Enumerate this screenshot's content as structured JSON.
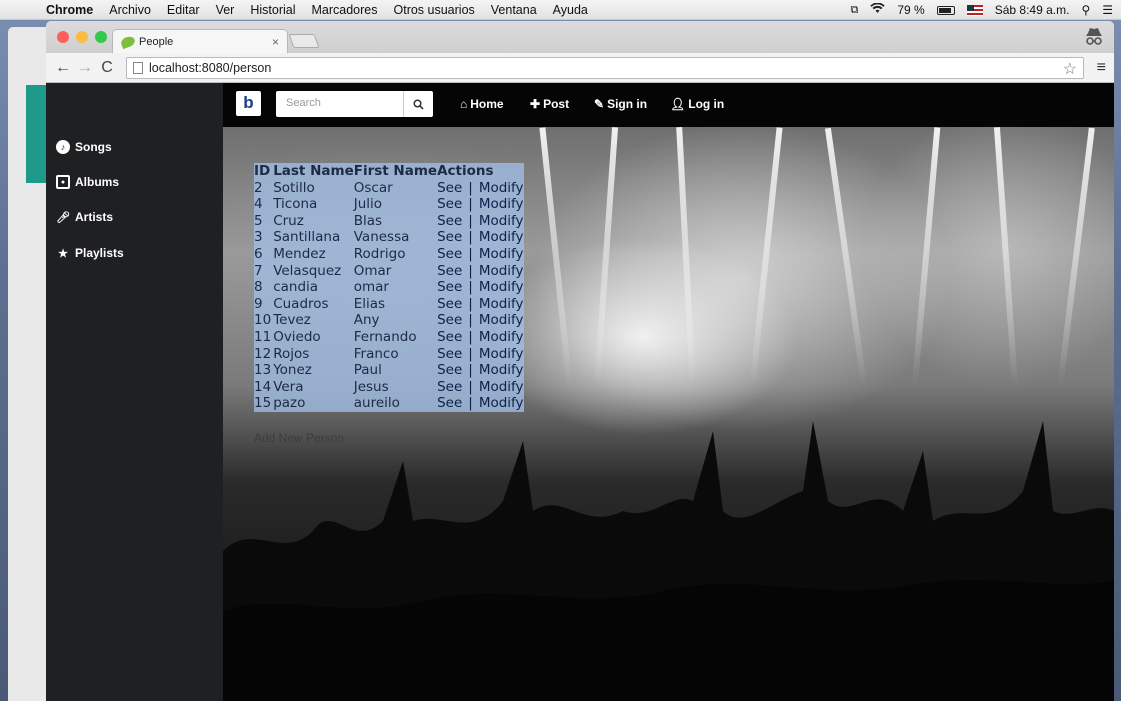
{
  "menubar": {
    "apple": "",
    "items": [
      "Chrome",
      "Archivo",
      "Editar",
      "Ver",
      "Historial",
      "Marcadores",
      "Otros usuarios",
      "Ventana",
      "Ayuda"
    ],
    "battery": "79 %",
    "clock": "Sáb 8:49 a.m."
  },
  "browser": {
    "tab_title": "People",
    "tab_close": "×",
    "url": "localhost:8080/person"
  },
  "sidebar": {
    "items": [
      {
        "label": "Songs",
        "icon": "music-disc-icon"
      },
      {
        "label": "Albums",
        "icon": "album-icon"
      },
      {
        "label": "Artists",
        "icon": "microphone-icon"
      },
      {
        "label": "Playlists",
        "icon": "star-icon"
      }
    ]
  },
  "topnav": {
    "brand": "b",
    "search_placeholder": "Search",
    "links": [
      {
        "label": "Home",
        "icon": "home-icon"
      },
      {
        "label": "Post",
        "icon": "plus-icon"
      },
      {
        "label": "Sign in",
        "icon": "edit-icon"
      },
      {
        "label": "Log in",
        "icon": "user-icon"
      }
    ]
  },
  "table": {
    "headers": [
      "ID",
      "Last Name",
      "First Name",
      "Actions"
    ],
    "see_label": "See",
    "separator": "|",
    "modify_label": "Modify",
    "rows": [
      {
        "id": "2",
        "last": "Sotillo",
        "first": "Oscar"
      },
      {
        "id": "4",
        "last": "Ticona",
        "first": "Julio"
      },
      {
        "id": "5",
        "last": "Cruz",
        "first": "Blas"
      },
      {
        "id": "3",
        "last": "Santillana",
        "first": "Vanessa"
      },
      {
        "id": "6",
        "last": "Mendez",
        "first": "Rodrigo"
      },
      {
        "id": "7",
        "last": "Velasquez",
        "first": "Omar"
      },
      {
        "id": "8",
        "last": "candia",
        "first": "omar"
      },
      {
        "id": "9",
        "last": "Cuadros",
        "first": "Elias"
      },
      {
        "id": "10",
        "last": "Tevez",
        "first": "Any"
      },
      {
        "id": "11",
        "last": "Oviedo",
        "first": "Fernando"
      },
      {
        "id": "12",
        "last": "Rojos",
        "first": "Franco"
      },
      {
        "id": "13",
        "last": "Yonez",
        "first": "Paul"
      },
      {
        "id": "14",
        "last": "Vera",
        "first": "Jesus"
      },
      {
        "id": "15",
        "last": "pazo",
        "first": "aureilo"
      }
    ]
  },
  "add_new_label": "Add New Person",
  "colors": {
    "sidebar_bg": "#1f2022",
    "topnav_bg": "#050505",
    "selection": "#a0bee6",
    "brand_blue": "#1a3b8a"
  }
}
